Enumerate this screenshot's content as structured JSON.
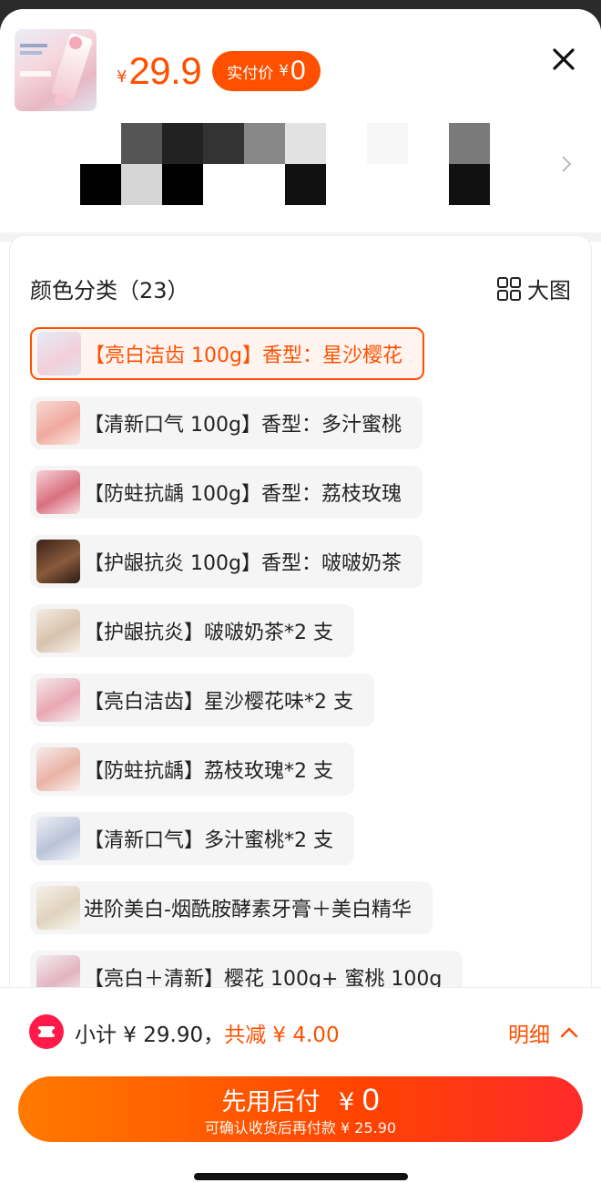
{
  "header": {
    "currency_symbol": "¥",
    "price": "29.9",
    "paid_label": "实付价",
    "paid_currency": "¥",
    "paid_value": "0",
    "thumb_icon": "toothpaste-product-image"
  },
  "sku_panel": {
    "title": "颜色分类（23）",
    "big_image_label": "大图",
    "options": [
      {
        "label": "【亮白洁齿 100g】香型：星沙樱花",
        "selected": true
      },
      {
        "label": "【清新口气 100g】香型：多汁蜜桃",
        "selected": false
      },
      {
        "label": "【防蛀抗龋 100g】香型：荔枝玫瑰",
        "selected": false
      },
      {
        "label": "【护龈抗炎 100g】香型：啵啵奶茶",
        "selected": false
      },
      {
        "label": "【护龈抗炎】啵啵奶茶*2 支",
        "selected": false
      },
      {
        "label": "【亮白洁齿】星沙樱花味*2 支",
        "selected": false
      },
      {
        "label": "【防蛀抗龋】荔枝玫瑰*2 支",
        "selected": false
      },
      {
        "label": "【清新口气】多汁蜜桃*2 支",
        "selected": false
      },
      {
        "label": "进阶美白-烟酰胺酵素牙膏＋美白精华",
        "selected": false
      },
      {
        "label": "【亮白＋清新】樱花 100g+ 蜜桃 100g",
        "selected": false
      }
    ]
  },
  "footer": {
    "subtotal_text": "小计 ¥ 29.90，",
    "discount_text": "共减 ¥ 4.00",
    "detail_label": "明细",
    "cta_main_label": "先用后付",
    "cta_currency": "¥",
    "cta_value": "0",
    "cta_sub": "可确认收货后再付款 ¥ 25.90"
  },
  "colors": {
    "accent": "#ff5000",
    "cta_start": "#ff7a00",
    "cta_end": "#ff2a2a"
  }
}
